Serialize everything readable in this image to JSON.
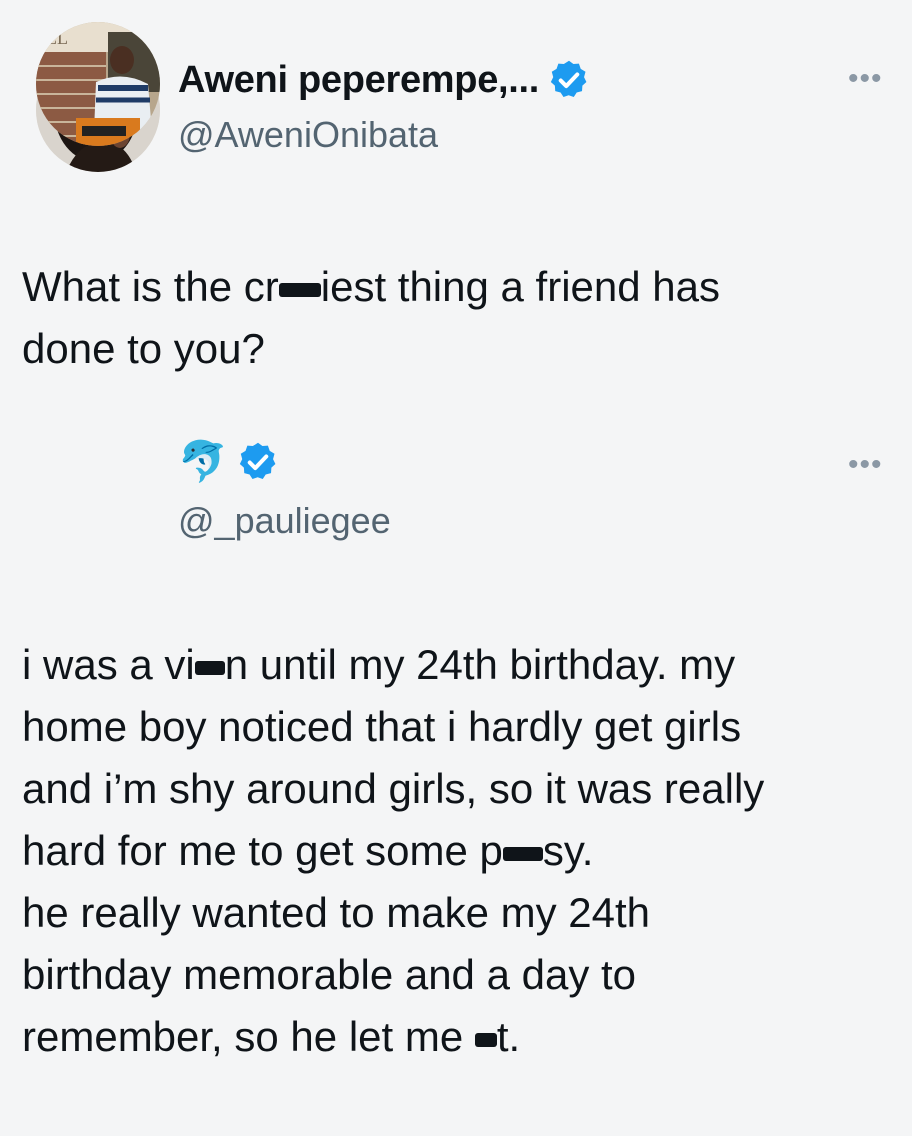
{
  "tweet1": {
    "display_name": "Aweni peperempe,...",
    "handle": "@AweniOnibata",
    "more_icon": "ellipsis-icon",
    "text_before": "What is the cr",
    "text_after": "iest thing a friend has\ndone to you?"
  },
  "tweet2": {
    "display_name_emoji": "🐬",
    "handle": "@_pauliegee",
    "more_icon": "ellipsis-icon",
    "text_part1": "i was a vi",
    "text_part2": "n until my 24th birthday. my\nhome boy noticed that i hardly get girls\nand i’m shy around girls, so it was really\nhard for me to get some p",
    "text_part3": "sy.\nhe really wanted to make my 24th\nbirthday memorable and a day to\nremember, so he let me ",
    "text_part4": "t."
  },
  "colors": {
    "verified": "#1d9bf0",
    "handle": "#536471",
    "background": "#f4f5f6"
  }
}
